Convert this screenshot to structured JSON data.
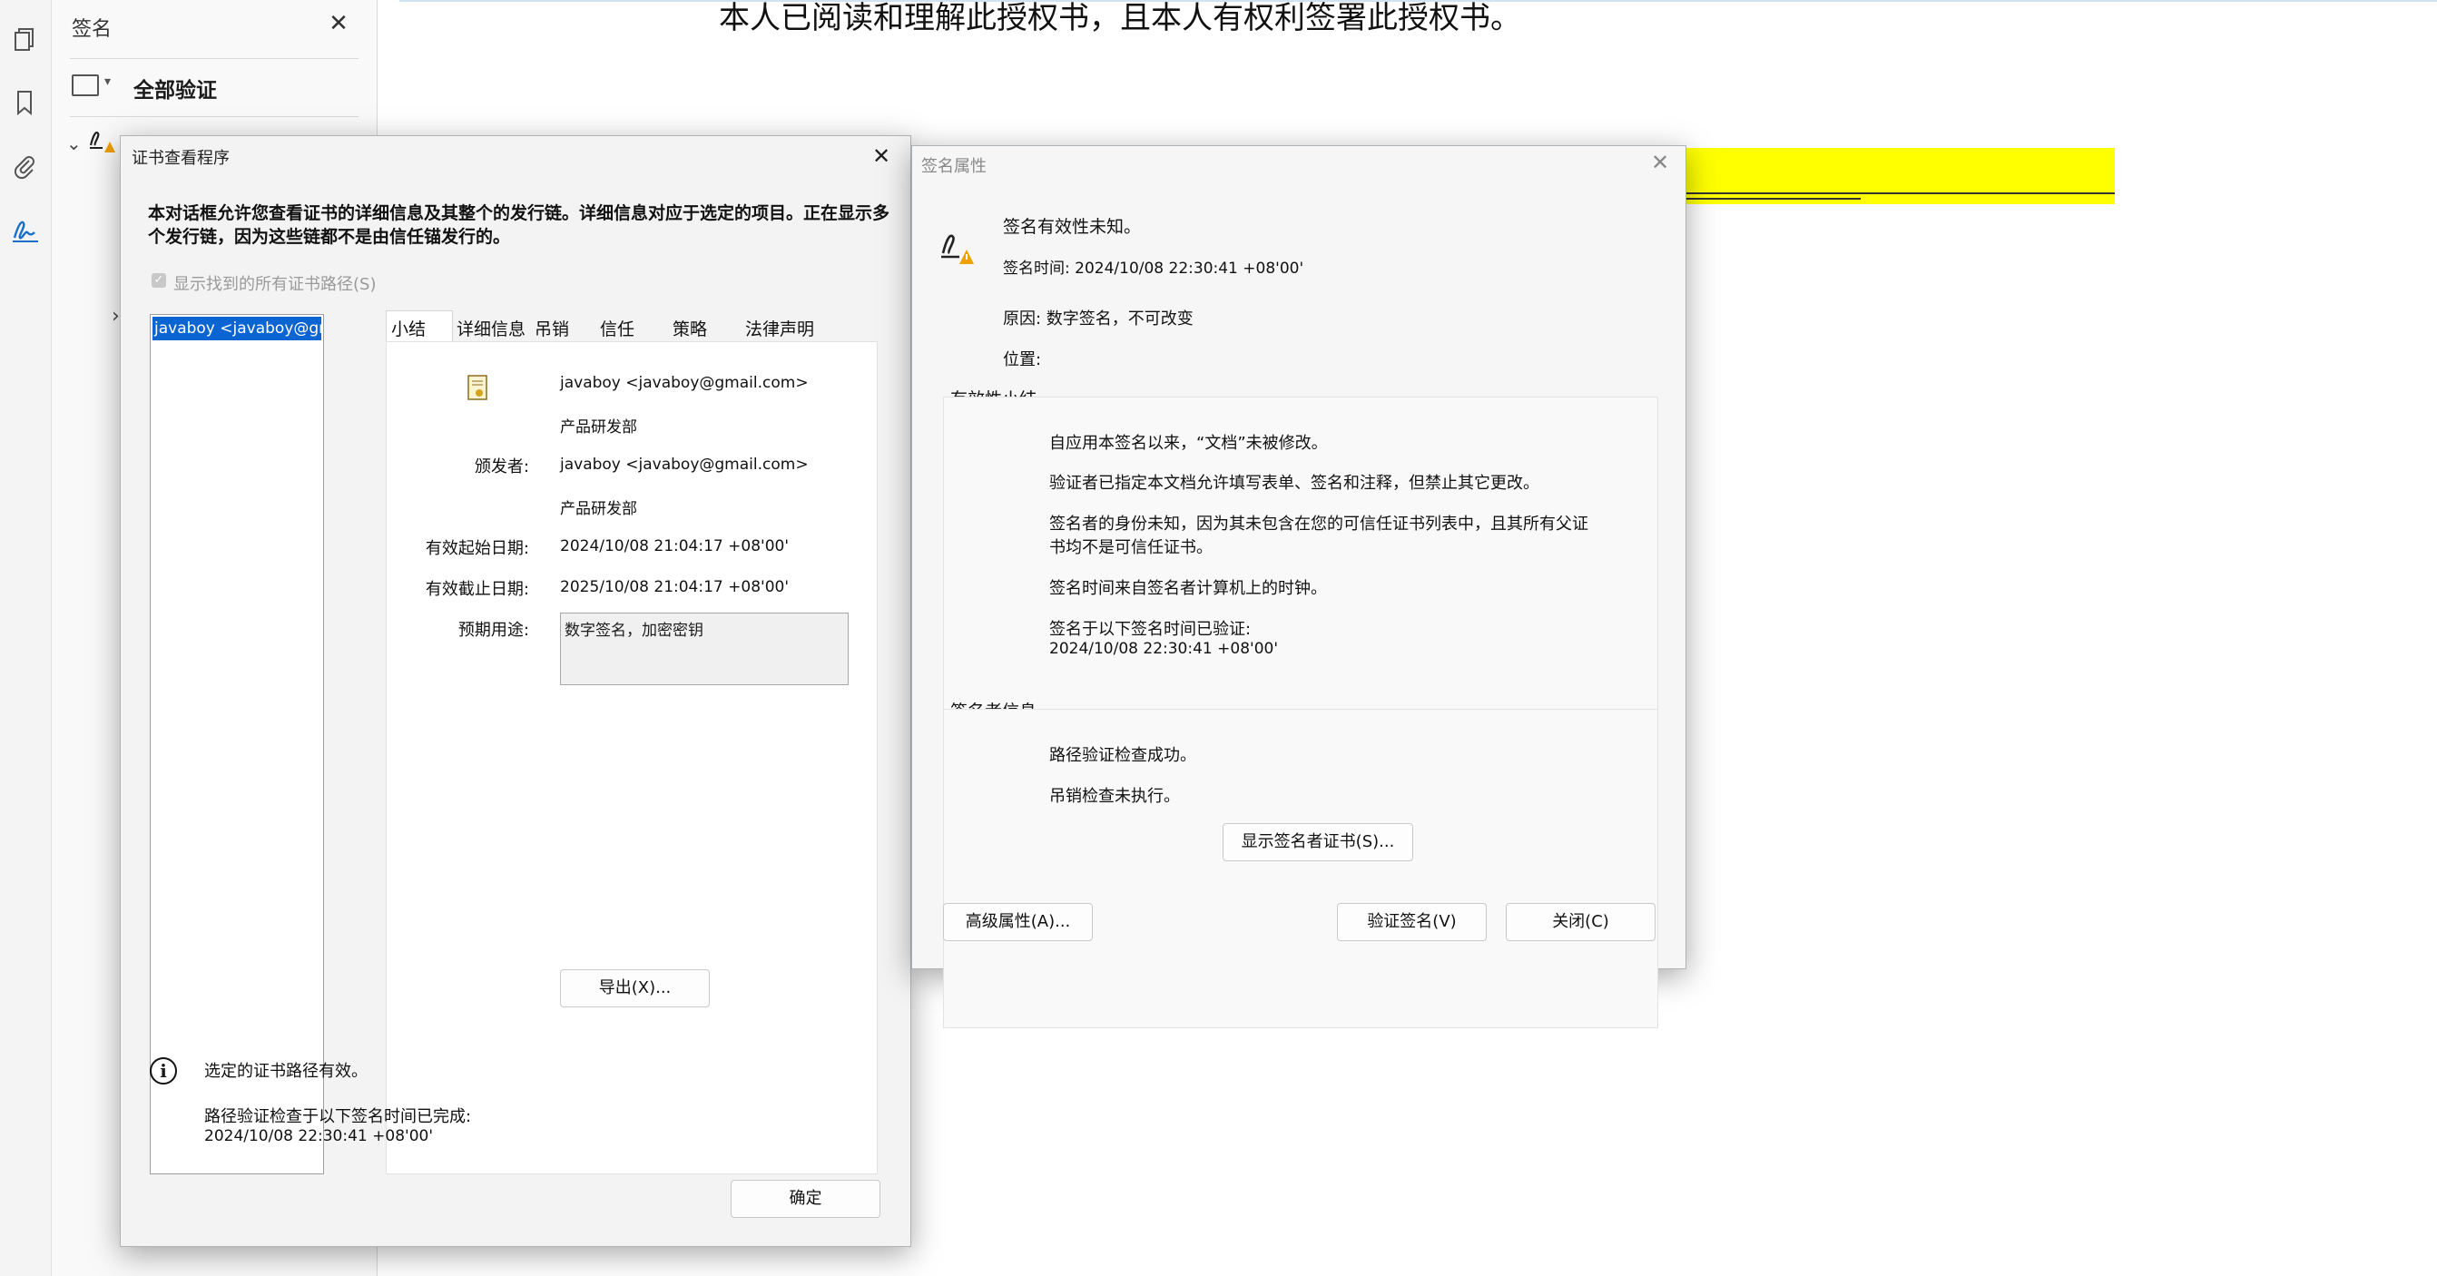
{
  "document": {
    "text": "本人已阅读和理解此授权书，且本人有权利签署此授权书。"
  },
  "rail": {
    "icons": [
      "pages-icon",
      "bookmark-icon",
      "attachment-icon",
      "signature-icon"
    ]
  },
  "sig_panel": {
    "title": "签名",
    "validate_all": "全部验证"
  },
  "cert_viewer": {
    "title": "证书查看程序",
    "description": "本对话框允许您查看证书的详细信息及其整个的发行链。详细信息对应于选定的项目。正在显示多个发行链，因为这些链都不是由信任锚发行的。",
    "show_all_paths": "显示找到的所有证书路径(S)",
    "chain_item": "javaboy <javaboy@gmail.com>",
    "tabs": [
      "小结",
      "详细信息",
      "吊销",
      "信任",
      "策略",
      "法律声明"
    ],
    "subject_name": "javaboy <javaboy@gmail.com>",
    "subject_org": "产品研发部",
    "issuer_label": "颁发者:",
    "issuer_name": "javaboy <javaboy@gmail.com>",
    "issuer_org": "产品研发部",
    "valid_from_label": "有效起始日期:",
    "valid_from": "2024/10/08 21:04:17 +08'00'",
    "valid_to_label": "有效截止日期:",
    "valid_to": "2025/10/08 21:04:17 +08'00'",
    "usage_label": "预期用途:",
    "usage": "数字签名，加密密钥",
    "export_button": "导出(X)...",
    "path_valid": "选定的证书路径有效。",
    "path_check_line1": "路径验证检查于以下签名时间已完成:",
    "path_check_line2": "2024/10/08 22:30:41 +08'00'",
    "ok_button": "确定"
  },
  "sig_props": {
    "title": "签名属性",
    "validity_unknown": "签名有效性未知。",
    "sign_time": "签名时间:   2024/10/08 22:30:41 +08'00'",
    "reason": "原因:   数字签名，不可改变",
    "location": "位置:",
    "summary_title": "有效性小结",
    "summary_lines": [
      "自应用本签名以来，“文档”未被修改。",
      "验证者已指定本文档允许填写表单、签名和注释，但禁止其它更改。",
      "签名者的身份未知，因为其未包含在您的可信任证书列表中，且其所有父证",
      "书均不是可信任证书。",
      "签名时间来自签名者计算机上的时钟。",
      "签名于以下签名时间已验证:",
      "2024/10/08 22:30:41 +08'00'"
    ],
    "signer_title": "签名者信息",
    "signer_lines": [
      "路径验证检查成功。",
      "吊销检查未执行。"
    ],
    "show_cert_button": "显示签名者证书(S)...",
    "advanced_button": "高级属性(A)...",
    "verify_button": "验证签名(V)",
    "close_button": "关闭(C)"
  }
}
